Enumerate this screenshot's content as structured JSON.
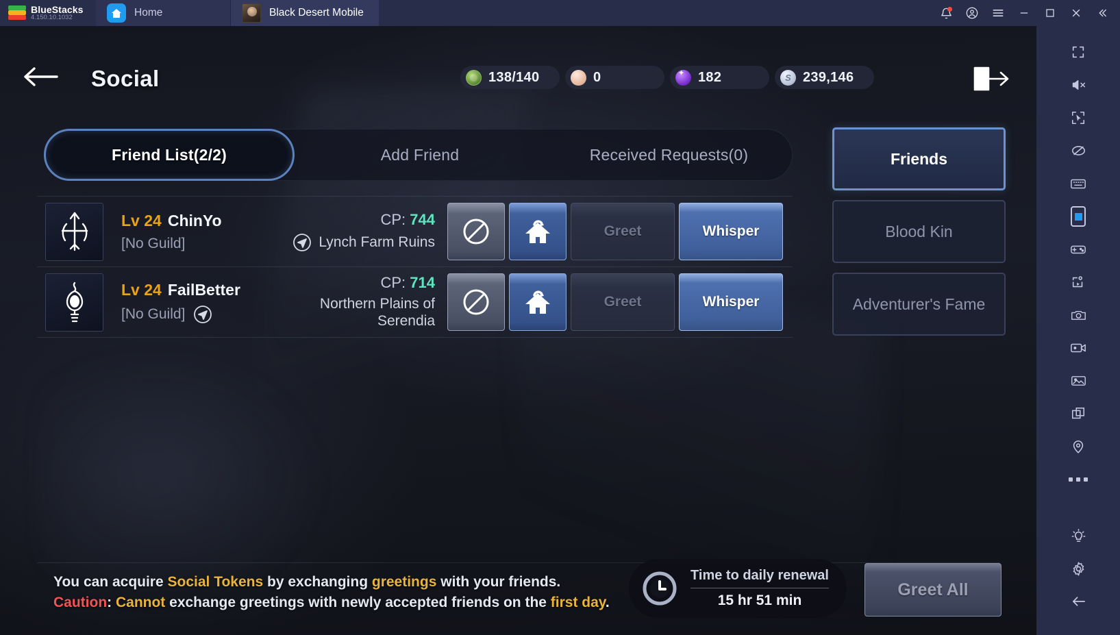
{
  "titlebar": {
    "brand_name": "BlueStacks",
    "version": "4.150.10.1032",
    "tabs": [
      {
        "label": "Home",
        "icon": "home-icon",
        "active": false
      },
      {
        "label": "Black Desert Mobile",
        "icon": "game-app-icon",
        "active": true
      }
    ],
    "controls": [
      {
        "name": "notifications-bell-icon",
        "badge": true
      },
      {
        "name": "account-icon"
      },
      {
        "name": "menu-icon"
      },
      {
        "name": "minimize-icon"
      },
      {
        "name": "maximize-icon"
      },
      {
        "name": "close-icon"
      },
      {
        "name": "collapse-icon"
      }
    ]
  },
  "game": {
    "header": {
      "back_icon": "back-arrow-icon",
      "title": "Social",
      "exit_icon": "exit-door-icon",
      "currencies": [
        {
          "name": "energy",
          "value": "138/140",
          "icon": "energy-orb-icon"
        },
        {
          "name": "contribution",
          "value": "0",
          "icon": "contribution-orb-icon"
        },
        {
          "name": "black-pearl",
          "value": "182",
          "icon": "pearl-orb-icon"
        },
        {
          "name": "silver",
          "value": "239,146",
          "icon": "silver-coin-icon"
        }
      ]
    },
    "tabs": [
      {
        "label": "Friend List(2/2)",
        "active": true
      },
      {
        "label": "Add Friend",
        "active": false
      },
      {
        "label": "Received Requests(0)",
        "active": false
      }
    ],
    "side_nav": [
      {
        "label": "Friends",
        "active": true
      },
      {
        "label": "Blood Kin",
        "active": false
      },
      {
        "label": "Adventurer's Fame",
        "active": false
      }
    ],
    "friends": [
      {
        "class_icon": "ranger-bow-icon",
        "level_label": "Lv",
        "level": "24",
        "name": "ChinYo",
        "guild": "[No Guild]",
        "cp_label": "CP:",
        "cp": "744",
        "location": "Lynch Farm Ruins",
        "location_icon": "navigation-arrow-icon",
        "location_icon_side": "left",
        "buttons": [
          {
            "name": "block-button",
            "icon": "block-circle-icon",
            "label": "",
            "style": "icon-gray"
          },
          {
            "name": "visit-house-button",
            "icon": "house-visit-icon",
            "label": "",
            "style": "icon-blue"
          },
          {
            "name": "greet-button",
            "icon": "",
            "label": "Greet",
            "style": "disabled"
          },
          {
            "name": "whisper-button",
            "icon": "",
            "label": "Whisper",
            "style": "primary"
          }
        ]
      },
      {
        "class_icon": "witch-staff-icon",
        "level_label": "Lv",
        "level": "24",
        "name": "FailBetter",
        "guild": "[No Guild]",
        "cp_label": "CP:",
        "cp": "714",
        "location": "Northern Plains of Serendia",
        "location_icon": "navigation-arrow-icon",
        "location_icon_side": "guild",
        "buttons": [
          {
            "name": "block-button",
            "icon": "block-circle-icon",
            "label": "",
            "style": "icon-gray"
          },
          {
            "name": "visit-house-button",
            "icon": "house-visit-icon",
            "label": "",
            "style": "icon-blue"
          },
          {
            "name": "greet-button",
            "icon": "",
            "label": "Greet",
            "style": "disabled"
          },
          {
            "name": "whisper-button",
            "icon": "",
            "label": "Whisper",
            "style": "primary"
          }
        ]
      }
    ],
    "notice": {
      "line1_a": "You can acquire ",
      "line1_b": "Social Tokens",
      "line1_c": " by exchanging ",
      "line1_d": "greetings",
      "line1_e": " with your friends.",
      "line2_a": "Caution",
      "line2_b": ": ",
      "line2_c": "Cannot",
      "line2_d": " exchange greetings with newly accepted friends on the ",
      "line2_e": "first day",
      "line2_f": "."
    },
    "timer": {
      "icon": "clock-icon",
      "title": "Time to daily renewal",
      "value": "15 hr 51 min"
    },
    "greet_all_label": "Greet All"
  },
  "bluestacks_toolbar": [
    {
      "name": "fullscreen-icon"
    },
    {
      "name": "mute-icon"
    },
    {
      "name": "cursor-capture-icon"
    },
    {
      "name": "eye-off-icon"
    },
    {
      "name": "keyboard-controls-icon"
    },
    {
      "name": "portrait-mode-icon",
      "active": true
    },
    {
      "name": "gamepad-icon"
    },
    {
      "name": "script-macro-icon"
    },
    {
      "name": "screenshot-camera-icon"
    },
    {
      "name": "video-record-icon"
    },
    {
      "name": "media-gallery-icon"
    },
    {
      "name": "multi-instance-icon"
    },
    {
      "name": "location-pin-icon"
    },
    {
      "name": "more-options-icon"
    },
    {
      "name": "tips-bulb-icon"
    },
    {
      "name": "settings-gear-icon"
    },
    {
      "name": "back-icon"
    }
  ],
  "colors": {
    "accent_blue": "#5b82bd",
    "gold": "#e8b43c",
    "cp_green": "#5fe3c0",
    "red": "#ef5555",
    "titlebar_bg": "#282d49"
  }
}
